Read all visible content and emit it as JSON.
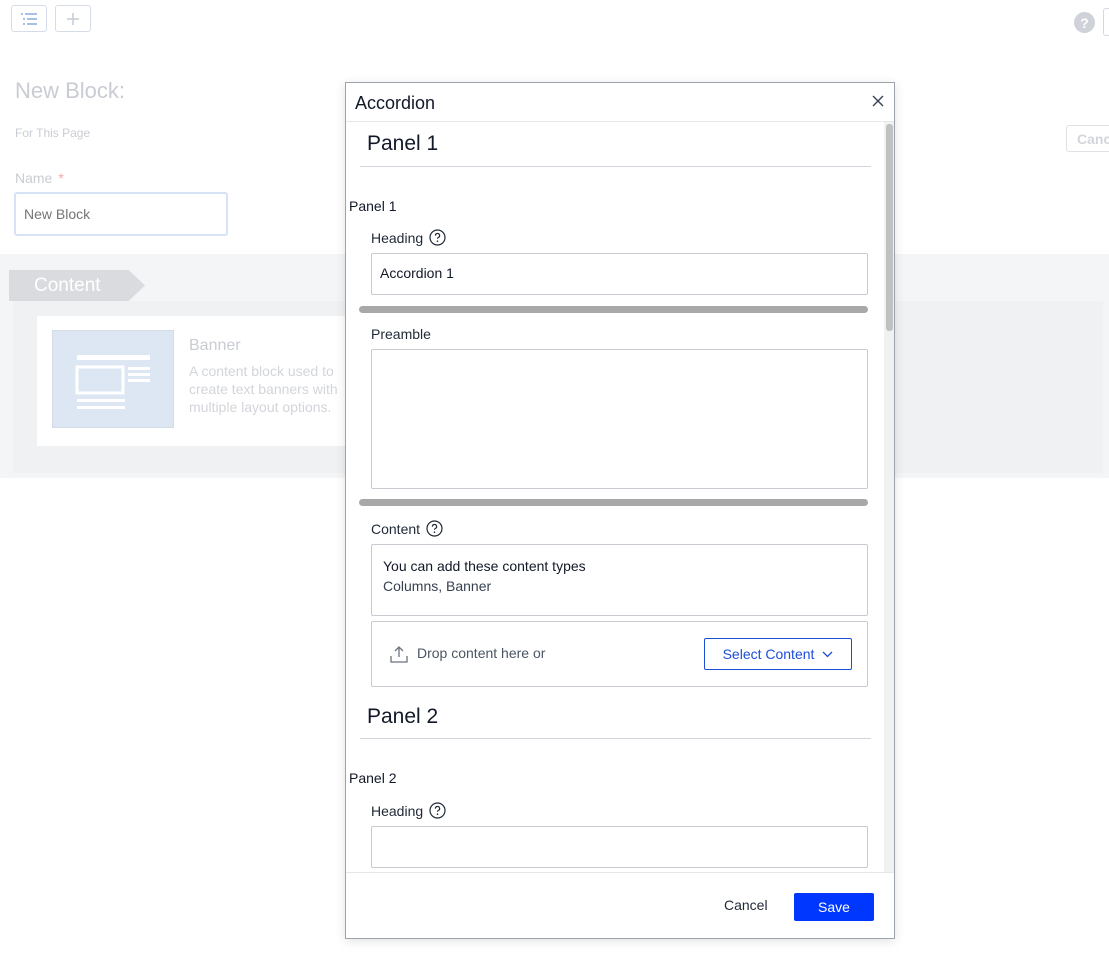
{
  "background": {
    "title": "New Block:",
    "subtitle": "For This Page",
    "cancel_label": "Canc",
    "name_label": "Name",
    "required_mark": "*",
    "name_placeholder": "New Block",
    "section_tab": "Content",
    "card": {
      "title": "Banner",
      "description": "A content block used to create text banners with multiple layout options."
    }
  },
  "dialog": {
    "title": "Accordion",
    "panels": [
      {
        "title": "Panel 1",
        "label": "Panel 1",
        "heading_label": "Heading",
        "heading_value": "Accordion 1",
        "preamble_label": "Preamble",
        "content_label": "Content",
        "content_info_title": "You can add these content types",
        "content_info_types": "Columns, Banner",
        "drop_text": "Drop content here or",
        "select_label": "Select Content"
      },
      {
        "title": "Panel 2",
        "label": "Panel 2",
        "heading_label": "Heading",
        "heading_value": ""
      }
    ],
    "footer": {
      "cancel_label": "Cancel",
      "save_label": "Save"
    }
  },
  "colors": {
    "primary": "#0037ff",
    "link": "#1d4ed8"
  }
}
